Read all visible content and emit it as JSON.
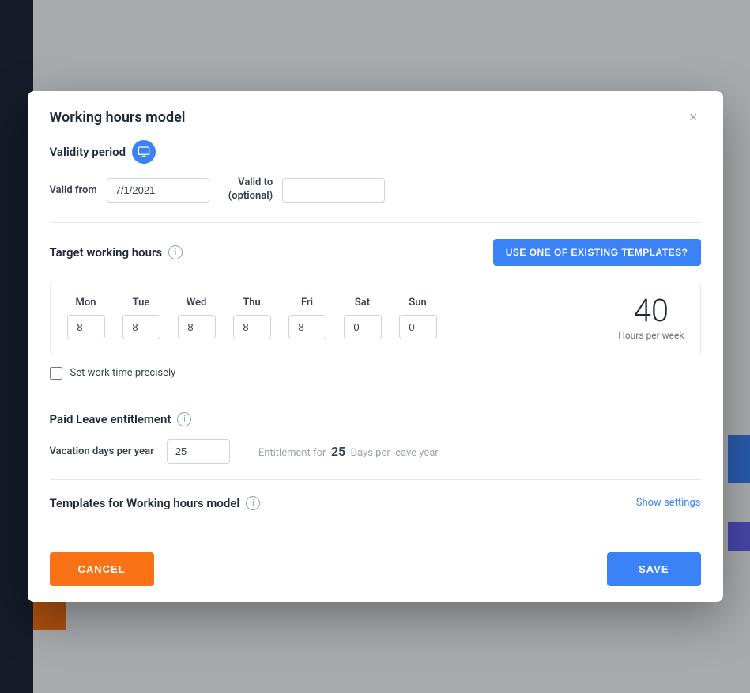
{
  "modal": {
    "title": "Working hours model",
    "close_label": "×"
  },
  "validity": {
    "section_title": "Validity period",
    "valid_from_label": "Valid from",
    "valid_from_value": "7/1/2021",
    "valid_to_label": "Valid to\n(optional)",
    "valid_to_placeholder": ""
  },
  "target_hours": {
    "section_title": "Target working hours",
    "use_template_btn": "USE ONE OF EXISTING TEMPLATES?",
    "info_icon": "i",
    "days": [
      {
        "label": "Mon",
        "value": "8"
      },
      {
        "label": "Tue",
        "value": "8"
      },
      {
        "label": "Wed",
        "value": "8"
      },
      {
        "label": "Thu",
        "value": "8"
      },
      {
        "label": "Fri",
        "value": "8"
      },
      {
        "label": "Sat",
        "value": "0"
      },
      {
        "label": "Sun",
        "value": "0"
      }
    ],
    "total_hours": "40",
    "hours_per_week_label": "Hours per week",
    "set_work_time_label": "Set work time precisely"
  },
  "paid_leave": {
    "section_title": "Paid Leave entitlement",
    "info_icon": "i",
    "vacation_label": "Vacation days per year",
    "vacation_value": "25",
    "entitlement_prefix": "Entitlement for",
    "entitlement_days": "25",
    "entitlement_suffix": "Days per leave year"
  },
  "templates": {
    "section_title": "Templates for Working hours model",
    "info_icon": "i",
    "show_settings_label": "Show settings"
  },
  "footer": {
    "cancel_label": "CANCEL",
    "save_label": "SAVE"
  },
  "icons": {
    "monitor": "🖥",
    "close": "×"
  }
}
